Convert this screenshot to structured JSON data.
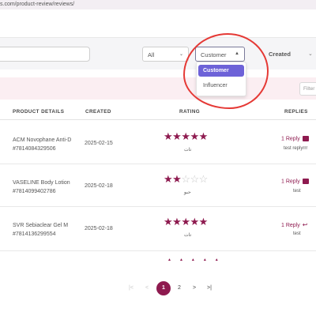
{
  "browser": {
    "url": "s.com/product-review/reviews/"
  },
  "filters": {
    "all_label": "All",
    "customer_label": "Customer",
    "created_label": "Created",
    "filter_button": "Filter"
  },
  "dropdown": {
    "options": [
      "Customer",
      "Influencer"
    ],
    "selected": "Customer"
  },
  "table": {
    "headers": [
      "PRODUCT DETAILS",
      "CREATED",
      "RATING",
      "REPLIES"
    ],
    "rows": [
      {
        "name": "ACM Novophane Anti-D",
        "sku": "#7814084329506",
        "date": "2025-02-15",
        "rating": 5,
        "review_text": "تات",
        "reply_label": "1 Reply",
        "reply_text": "test replyrrr"
      },
      {
        "name": "VASELINE Body Lotion",
        "sku": "#7814099402786",
        "date": "2025-02-18",
        "rating": 2,
        "review_text": "حبو",
        "reply_label": "1 Reply",
        "reply_text": "test"
      },
      {
        "name": "SVR Sebiaclear Gel M",
        "sku": "#7814136299554",
        "date": "2025-02-18",
        "rating": 5,
        "review_text": "تات",
        "reply_label": "1 Reply",
        "reply_text": "test"
      }
    ]
  },
  "pagination": {
    "first": "|<",
    "prev": "<",
    "pages": [
      "1",
      "2"
    ],
    "current": "1",
    "next": ">",
    "last": ">|"
  },
  "colors": {
    "accent": "#8e1a4f",
    "dropdown_active": "#6d62d8",
    "annotation": "#e53935"
  }
}
